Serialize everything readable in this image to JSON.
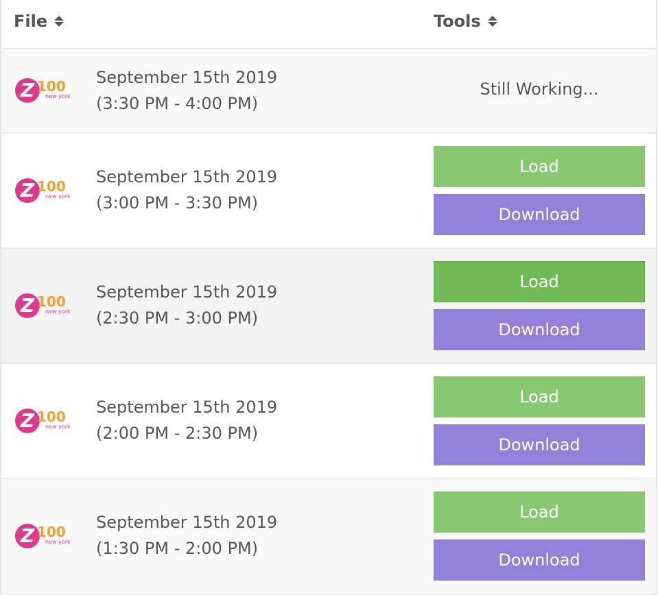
{
  "header": {
    "file_label": "File",
    "tools_label": "Tools"
  },
  "colors": {
    "load": "#88c872",
    "load_active": "#70bb55",
    "download": "#9281d9",
    "logo_pink": "#e0388a",
    "logo_orange": "#f0a030"
  },
  "logo": {
    "z": "Z",
    "number": "100",
    "sub": "new york"
  },
  "rows": [
    {
      "date": "September 15th 2019",
      "time": "(3:30 PM - 4:00 PM)",
      "status": "Still Working..."
    },
    {
      "date": "September 15th 2019",
      "time": "(3:00 PM - 3:30 PM)",
      "load_label": "Load",
      "download_label": "Download"
    },
    {
      "date": "September 15th 2019",
      "time": "(2:30 PM - 3:00 PM)",
      "load_label": "Load",
      "download_label": "Download"
    },
    {
      "date": "September 15th 2019",
      "time": "(2:00 PM - 2:30 PM)",
      "load_label": "Load",
      "download_label": "Download"
    },
    {
      "date": "September 15th 2019",
      "time": "(1:30 PM - 2:00 PM)",
      "load_label": "Load",
      "download_label": "Download"
    }
  ]
}
